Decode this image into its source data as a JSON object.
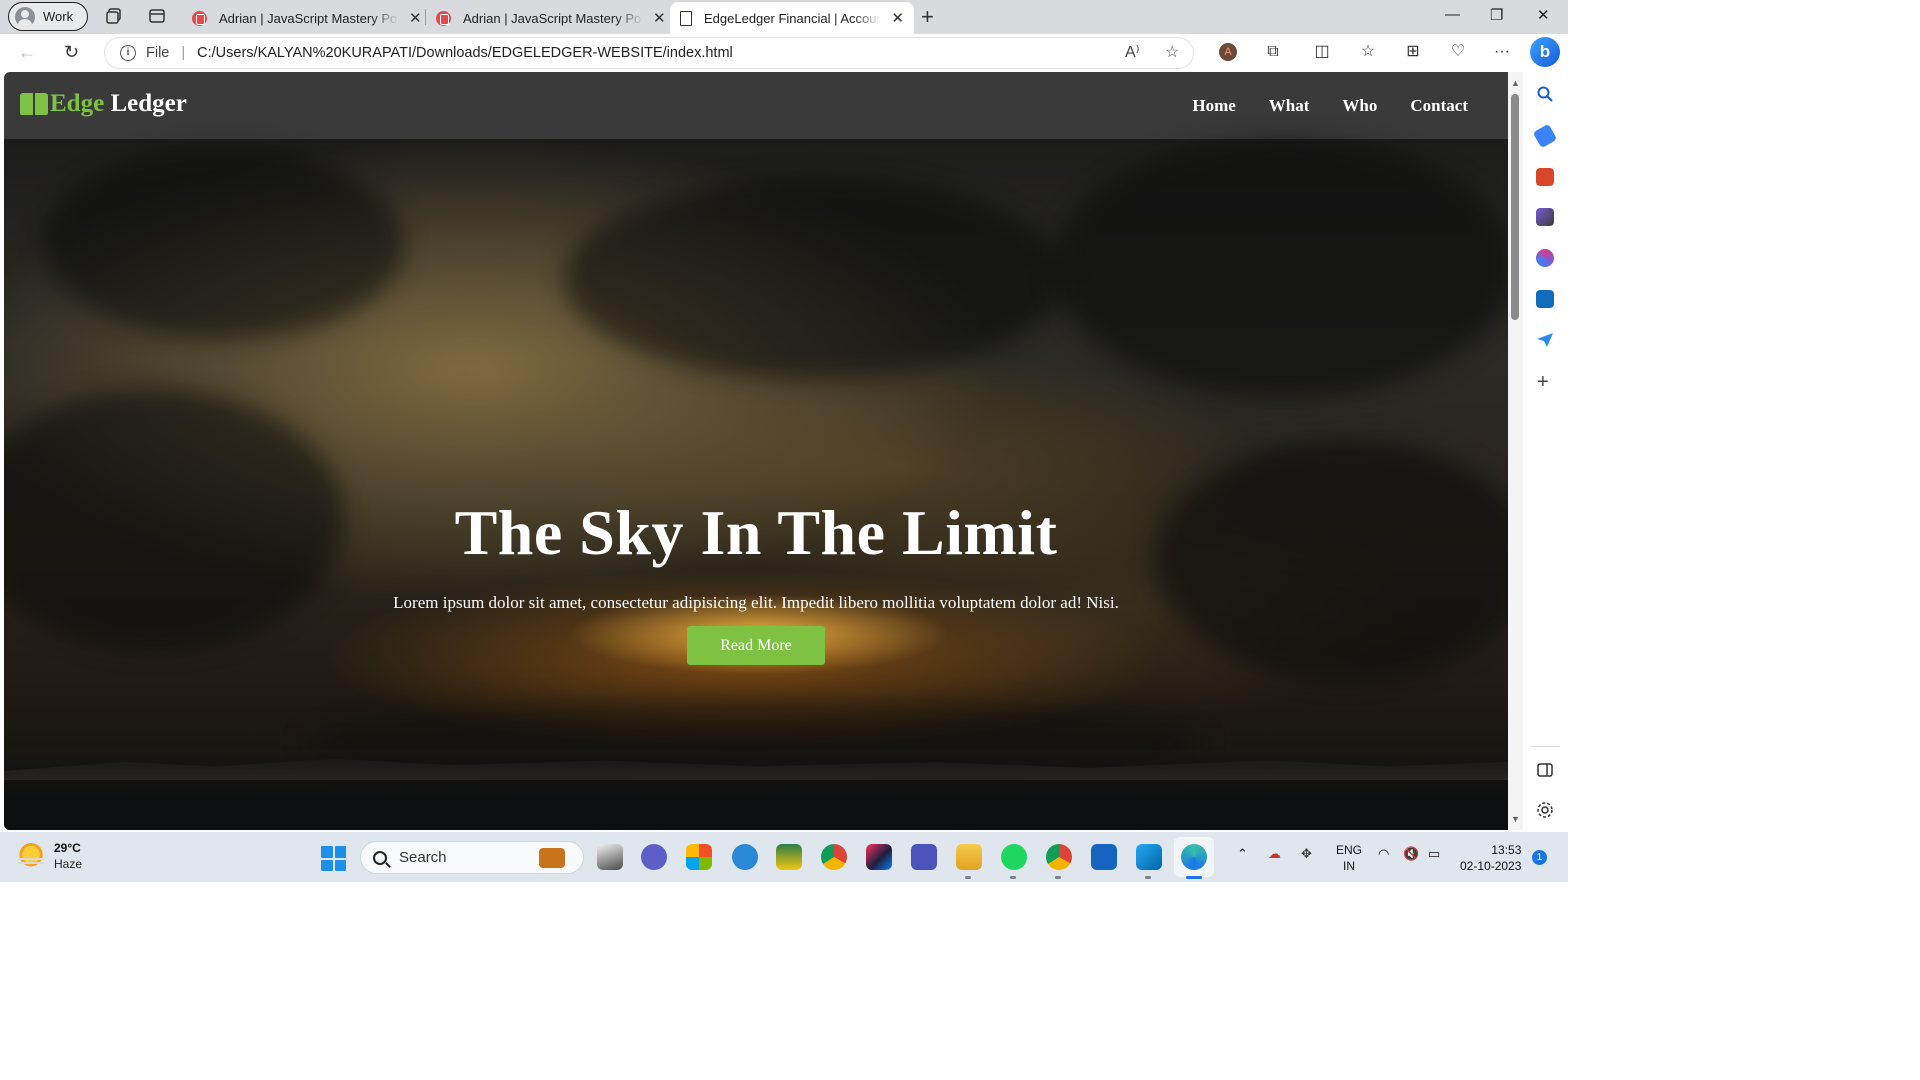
{
  "browser": {
    "profile": "Work",
    "tabs": [
      {
        "title": "Adrian | JavaScript Mastery Portfolio",
        "active": false
      },
      {
        "title": "Adrian | JavaScript Mastery Portfolio",
        "active": false
      },
      {
        "title": "EdgeLedger Financial | Accounting",
        "active": true
      }
    ],
    "address": {
      "scheme_label": "File",
      "url": "C:/Users/KALYAN%20KURAPATI/Downloads/EDGELEDGER-WEBSITE/index.html"
    }
  },
  "site": {
    "logo": {
      "accent": "Edge",
      "rest": " Ledger"
    },
    "nav": [
      "Home",
      "What",
      "Who",
      "Contact"
    ],
    "hero": {
      "title": "The Sky In The Limit",
      "subtitle": "Lorem ipsum dolor sit amet, consectetur adipisicing elit. Impedit libero mollitia voluptatem dolor ad! Nisi.",
      "button": "Read More"
    },
    "colors": {
      "accent": "#7dc242",
      "nav_bg": "#3a3a3a"
    }
  },
  "taskbar": {
    "weather": {
      "temp": "29°C",
      "condition": "Haze"
    },
    "search_label": "Search",
    "language": {
      "line1": "ENG",
      "line2": "IN"
    },
    "clock": {
      "time": "13:53",
      "date": "02-10-2023"
    },
    "notifications": "1"
  }
}
